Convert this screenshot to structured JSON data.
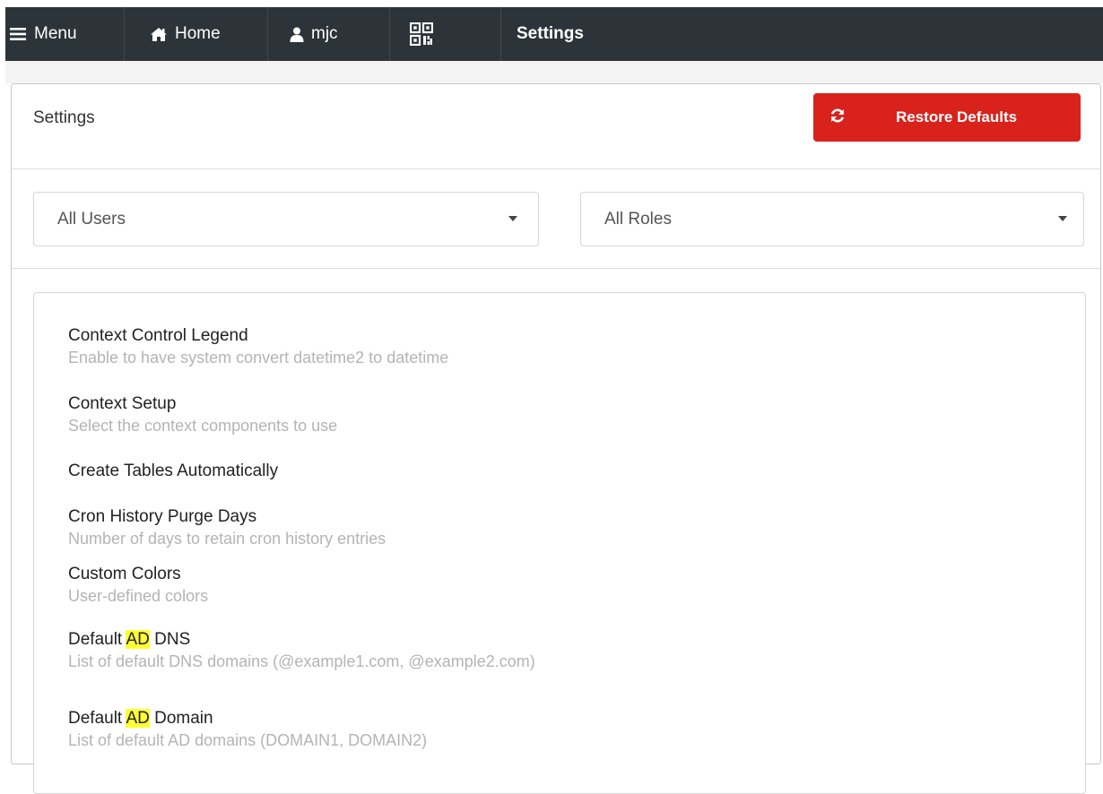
{
  "navbar": {
    "menu_label": "Menu",
    "home_label": "Home",
    "user_label": "mjc",
    "page_title": "Settings"
  },
  "panel": {
    "title": "Settings",
    "restore_button_label": "Restore Defaults"
  },
  "filters": {
    "users_value": "All Users",
    "roles_value": "All Roles"
  },
  "settings": [
    {
      "name": "Context Control Legend",
      "description": "Enable to have system convert datetime2 to datetime"
    },
    {
      "name": "Context Setup",
      "description": "Select the context components to use"
    },
    {
      "name": "Create Tables Automatically",
      "description": ""
    },
    {
      "name": "Cron History Purge Days",
      "description": "Number of days to retain cron history entries"
    },
    {
      "name": "Custom Colors",
      "description": "User-defined colors"
    },
    {
      "name_pre": "Default ",
      "name_match": "AD",
      "name_post": " DNS",
      "description": "List of default DNS domains (@example1.com, @example2.com)"
    },
    {
      "name_pre": "Default ",
      "name_match": "AD",
      "name_post": " Domain",
      "description": "List of default AD domains (DOMAIN1, DOMAIN2)"
    }
  ],
  "colors": {
    "navbar_bg": "#2c3439",
    "restore_button_bg": "#d9221c",
    "search_highlight": "#ffff33",
    "description_text": "#b4b4b4"
  },
  "icons": {
    "menu": "hamburger-icon",
    "home": "home-icon",
    "user": "user-icon",
    "qr": "qr-code-icon",
    "restore": "refresh-icon",
    "dropdown": "caret-down-icon"
  }
}
